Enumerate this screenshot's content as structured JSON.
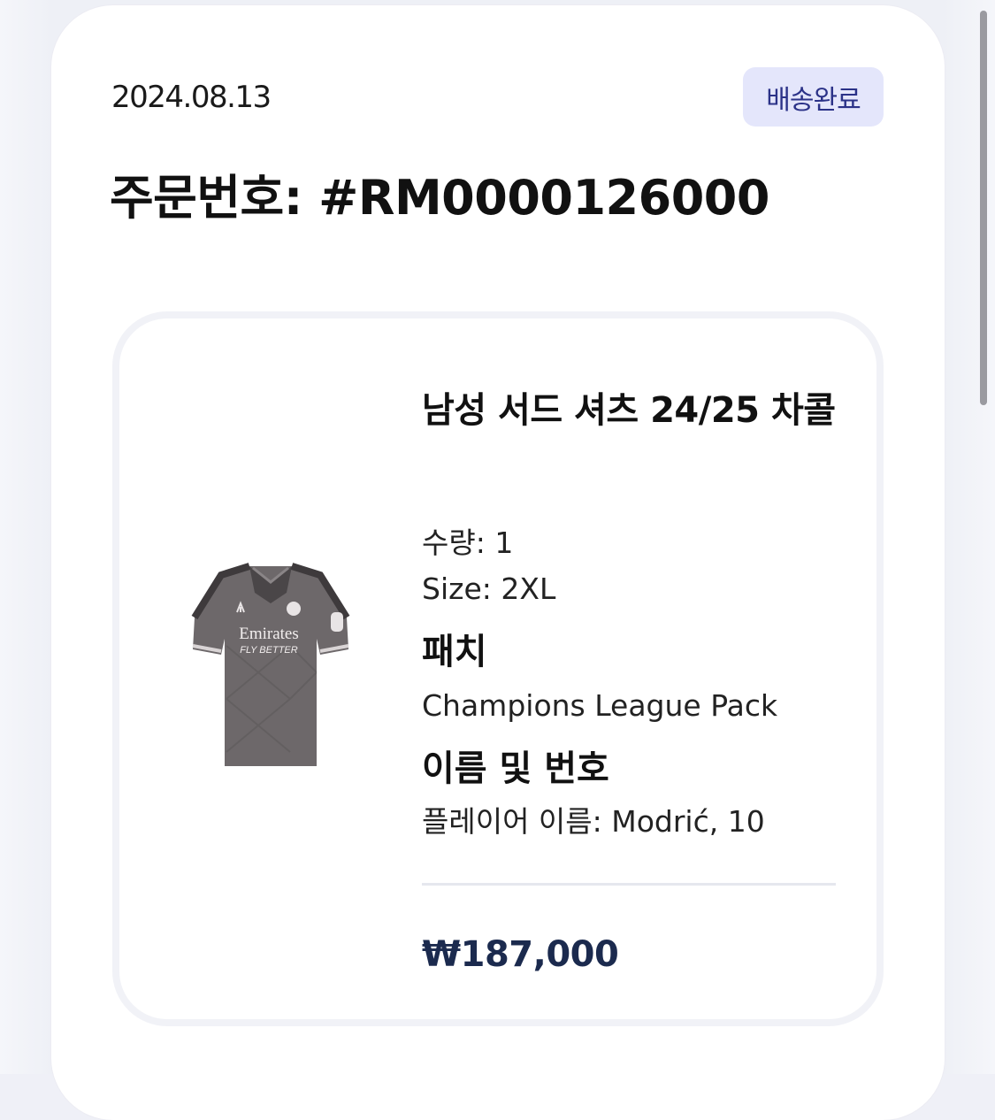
{
  "order": {
    "date": "2024.08.13",
    "status_label": "배송완료",
    "number_label": "주문번호: #RM0000126000"
  },
  "item": {
    "title": "남성 서드 셔츠 24/25 차콜",
    "quantity_text": "수량: 1",
    "size_text": "Size: 2XL",
    "patch_heading": "패치",
    "patch_value": "Champions League Pack",
    "name_number_heading": "이름 및 번호",
    "player_name_text": "플레이어 이름: Modrić, 10",
    "price": "₩187,000",
    "image": {
      "sponsor_text": "Emirates",
      "sponsor_tagline": "FLY BETTER"
    }
  },
  "colors": {
    "badge_bg": "#e4e6fb",
    "badge_text": "#2b3288",
    "price_text": "#1b2a4e",
    "jersey": "#6b6668"
  }
}
